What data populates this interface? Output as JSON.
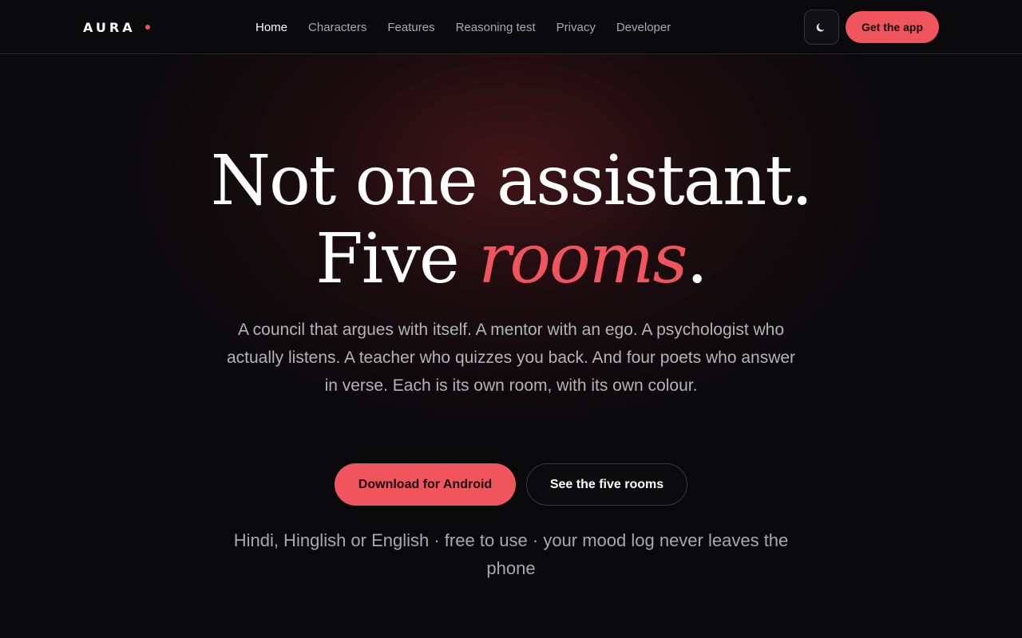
{
  "brand": {
    "name": "AURA",
    "accent_color": "#f0555d"
  },
  "nav": {
    "items": [
      {
        "label": "Home",
        "active": true
      },
      {
        "label": "Characters"
      },
      {
        "label": "Features"
      },
      {
        "label": "Reasoning test"
      },
      {
        "label": "Privacy"
      },
      {
        "label": "Developer"
      }
    ],
    "theme_toggle_icon": "moon-icon",
    "get_app_label": "Get the app"
  },
  "hero": {
    "title_line1": "Not one assistant.",
    "title_line2_prefix": "Five ",
    "title_line2_accent": "rooms",
    "title_line2_suffix": ".",
    "subtitle": "A council that argues with itself. A mentor with an ego. A psychologist who actually listens. A teacher who quizzes you back. And four poets who answer in verse. Each is its own room, with its own colour.",
    "primary_cta": "Download for Android",
    "secondary_cta": "See the five rooms",
    "note": "Hindi, Hinglish or English · free to use · your mood log never leaves the phone"
  },
  "colors": {
    "background": "#09090b",
    "accent": "#f0555d",
    "text_muted": "#a8a8b0"
  }
}
